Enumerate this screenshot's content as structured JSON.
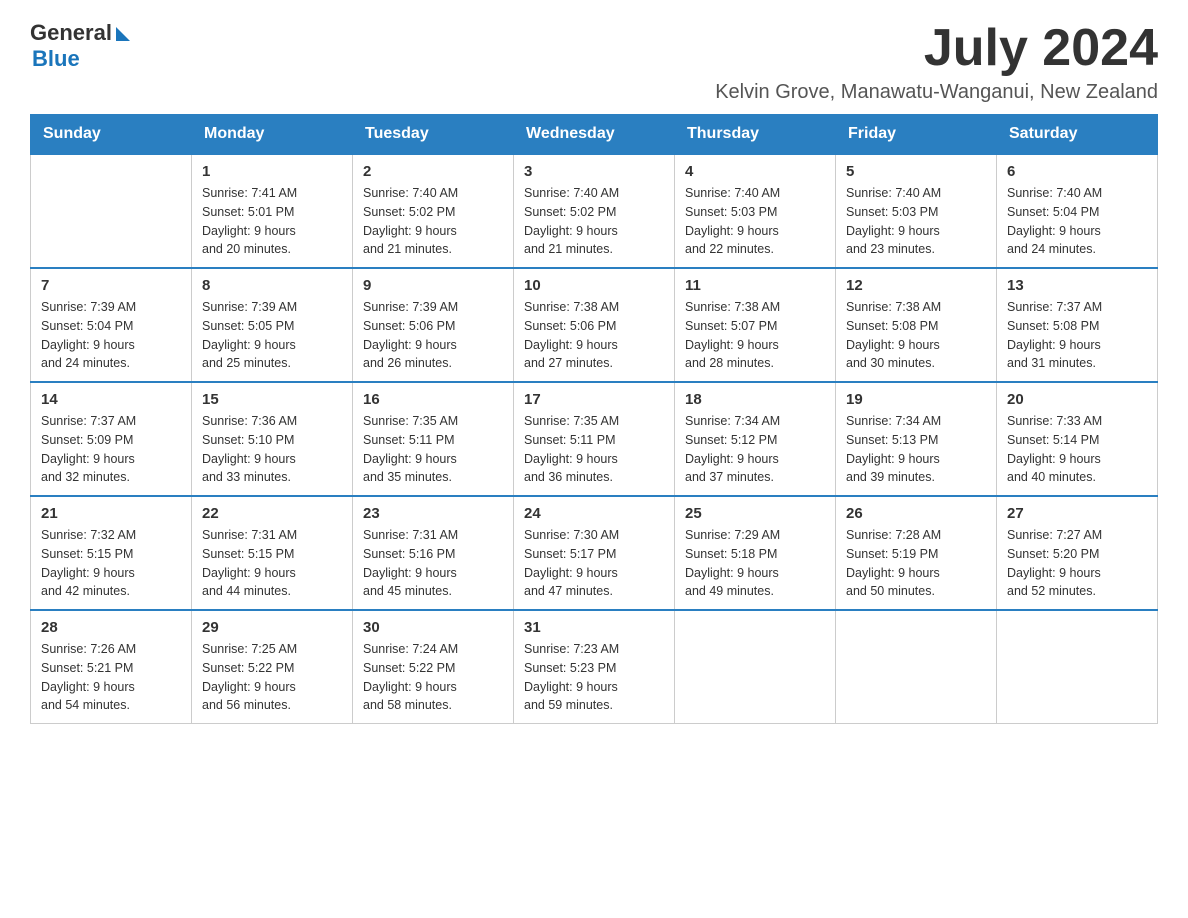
{
  "header": {
    "logo_general": "General",
    "logo_blue": "Blue",
    "month_title": "July 2024",
    "location": "Kelvin Grove, Manawatu-Wanganui, New Zealand"
  },
  "days_of_week": [
    "Sunday",
    "Monday",
    "Tuesday",
    "Wednesday",
    "Thursday",
    "Friday",
    "Saturday"
  ],
  "weeks": [
    [
      {
        "day": "",
        "info": ""
      },
      {
        "day": "1",
        "info": "Sunrise: 7:41 AM\nSunset: 5:01 PM\nDaylight: 9 hours\nand 20 minutes."
      },
      {
        "day": "2",
        "info": "Sunrise: 7:40 AM\nSunset: 5:02 PM\nDaylight: 9 hours\nand 21 minutes."
      },
      {
        "day": "3",
        "info": "Sunrise: 7:40 AM\nSunset: 5:02 PM\nDaylight: 9 hours\nand 21 minutes."
      },
      {
        "day": "4",
        "info": "Sunrise: 7:40 AM\nSunset: 5:03 PM\nDaylight: 9 hours\nand 22 minutes."
      },
      {
        "day": "5",
        "info": "Sunrise: 7:40 AM\nSunset: 5:03 PM\nDaylight: 9 hours\nand 23 minutes."
      },
      {
        "day": "6",
        "info": "Sunrise: 7:40 AM\nSunset: 5:04 PM\nDaylight: 9 hours\nand 24 minutes."
      }
    ],
    [
      {
        "day": "7",
        "info": "Sunrise: 7:39 AM\nSunset: 5:04 PM\nDaylight: 9 hours\nand 24 minutes."
      },
      {
        "day": "8",
        "info": "Sunrise: 7:39 AM\nSunset: 5:05 PM\nDaylight: 9 hours\nand 25 minutes."
      },
      {
        "day": "9",
        "info": "Sunrise: 7:39 AM\nSunset: 5:06 PM\nDaylight: 9 hours\nand 26 minutes."
      },
      {
        "day": "10",
        "info": "Sunrise: 7:38 AM\nSunset: 5:06 PM\nDaylight: 9 hours\nand 27 minutes."
      },
      {
        "day": "11",
        "info": "Sunrise: 7:38 AM\nSunset: 5:07 PM\nDaylight: 9 hours\nand 28 minutes."
      },
      {
        "day": "12",
        "info": "Sunrise: 7:38 AM\nSunset: 5:08 PM\nDaylight: 9 hours\nand 30 minutes."
      },
      {
        "day": "13",
        "info": "Sunrise: 7:37 AM\nSunset: 5:08 PM\nDaylight: 9 hours\nand 31 minutes."
      }
    ],
    [
      {
        "day": "14",
        "info": "Sunrise: 7:37 AM\nSunset: 5:09 PM\nDaylight: 9 hours\nand 32 minutes."
      },
      {
        "day": "15",
        "info": "Sunrise: 7:36 AM\nSunset: 5:10 PM\nDaylight: 9 hours\nand 33 minutes."
      },
      {
        "day": "16",
        "info": "Sunrise: 7:35 AM\nSunset: 5:11 PM\nDaylight: 9 hours\nand 35 minutes."
      },
      {
        "day": "17",
        "info": "Sunrise: 7:35 AM\nSunset: 5:11 PM\nDaylight: 9 hours\nand 36 minutes."
      },
      {
        "day": "18",
        "info": "Sunrise: 7:34 AM\nSunset: 5:12 PM\nDaylight: 9 hours\nand 37 minutes."
      },
      {
        "day": "19",
        "info": "Sunrise: 7:34 AM\nSunset: 5:13 PM\nDaylight: 9 hours\nand 39 minutes."
      },
      {
        "day": "20",
        "info": "Sunrise: 7:33 AM\nSunset: 5:14 PM\nDaylight: 9 hours\nand 40 minutes."
      }
    ],
    [
      {
        "day": "21",
        "info": "Sunrise: 7:32 AM\nSunset: 5:15 PM\nDaylight: 9 hours\nand 42 minutes."
      },
      {
        "day": "22",
        "info": "Sunrise: 7:31 AM\nSunset: 5:15 PM\nDaylight: 9 hours\nand 44 minutes."
      },
      {
        "day": "23",
        "info": "Sunrise: 7:31 AM\nSunset: 5:16 PM\nDaylight: 9 hours\nand 45 minutes."
      },
      {
        "day": "24",
        "info": "Sunrise: 7:30 AM\nSunset: 5:17 PM\nDaylight: 9 hours\nand 47 minutes."
      },
      {
        "day": "25",
        "info": "Sunrise: 7:29 AM\nSunset: 5:18 PM\nDaylight: 9 hours\nand 49 minutes."
      },
      {
        "day": "26",
        "info": "Sunrise: 7:28 AM\nSunset: 5:19 PM\nDaylight: 9 hours\nand 50 minutes."
      },
      {
        "day": "27",
        "info": "Sunrise: 7:27 AM\nSunset: 5:20 PM\nDaylight: 9 hours\nand 52 minutes."
      }
    ],
    [
      {
        "day": "28",
        "info": "Sunrise: 7:26 AM\nSunset: 5:21 PM\nDaylight: 9 hours\nand 54 minutes."
      },
      {
        "day": "29",
        "info": "Sunrise: 7:25 AM\nSunset: 5:22 PM\nDaylight: 9 hours\nand 56 minutes."
      },
      {
        "day": "30",
        "info": "Sunrise: 7:24 AM\nSunset: 5:22 PM\nDaylight: 9 hours\nand 58 minutes."
      },
      {
        "day": "31",
        "info": "Sunrise: 7:23 AM\nSunset: 5:23 PM\nDaylight: 9 hours\nand 59 minutes."
      },
      {
        "day": "",
        "info": ""
      },
      {
        "day": "",
        "info": ""
      },
      {
        "day": "",
        "info": ""
      }
    ]
  ]
}
